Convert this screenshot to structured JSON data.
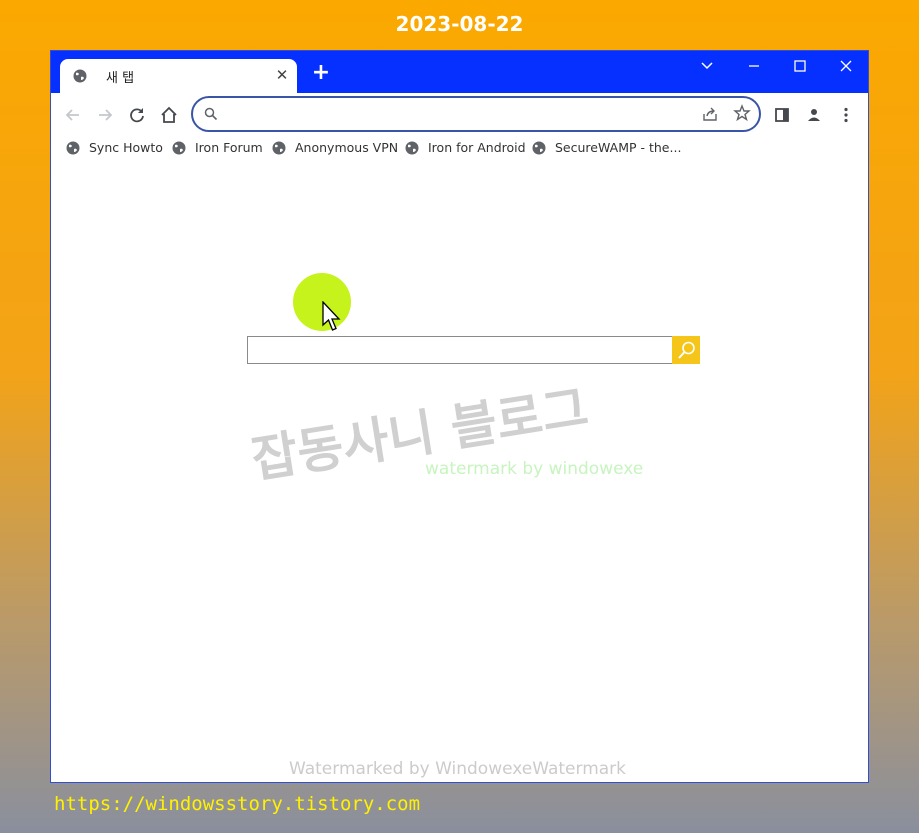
{
  "overlay": {
    "date": "2023-08-22",
    "url": "https://windowsstory.tistory.com"
  },
  "browser": {
    "tab": {
      "title": "새 탭",
      "icon": "globe-icon",
      "close_icon": "close-icon"
    },
    "new_tab_icon": "plus-icon",
    "window_controls": [
      "chevron-down-icon",
      "minimize-icon",
      "maximize-icon",
      "close-icon"
    ],
    "toolbar": {
      "buttons": [
        "back-arrow-icon",
        "forward-arrow-icon",
        "reload-icon",
        "home-icon"
      ],
      "omnibox": {
        "value": "",
        "placeholder": ""
      },
      "right_buttons": [
        "share-icon",
        "star-icon",
        "side-panel-icon",
        "profile-icon",
        "menu-icon"
      ]
    },
    "bookmarks": [
      {
        "label": "Sync Howto",
        "icon": "globe-icon"
      },
      {
        "label": "Iron Forum",
        "icon": "globe-icon"
      },
      {
        "label": "Anonymous VPN",
        "icon": "globe-icon"
      },
      {
        "label": "Iron for Android",
        "icon": "globe-icon"
      },
      {
        "label": "SecureWAMP - the...",
        "icon": "globe-icon"
      }
    ]
  },
  "page": {
    "search_value": "",
    "search_button_icon": "search-icon",
    "cursor_icon": "mouse-pointer-icon"
  },
  "watermarks": {
    "korean": "잡동사니 블로그",
    "green": "watermark by windowexe",
    "footer": "Watermarked by WindowexeWatermark"
  },
  "colors": {
    "titlebar": "#0630ff",
    "search_button": "#f5c51a",
    "cursor_halo": "#c6f31c",
    "url_text": "#fff200"
  }
}
